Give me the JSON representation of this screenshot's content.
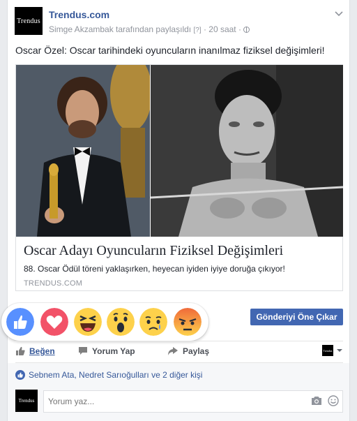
{
  "post": {
    "page_logo_text": "Trendus",
    "page_name": "Trendus.com",
    "shared_by": "Simge Akzambak tarafından paylaşıldı",
    "help_mark": "[?]",
    "separator": "·",
    "time": "20 saat",
    "separator2": "·",
    "text": "Oscar Özel: Oscar tarihindeki oyuncuların inanılmaz fiziksel değişimleri!"
  },
  "link": {
    "title": "Oscar Adayı Oyuncuların Fiziksel Değişimleri",
    "description": "88. Oscar Ödül töreni yaklaşırken, heyecan iyiden iyiye doruğa çıkıyor!",
    "domain": "TRENDUS.COM"
  },
  "reactions": [
    "like",
    "love",
    "haha",
    "wow",
    "sad",
    "angry"
  ],
  "boost_label": "Gönderiyi Öne Çıkar",
  "actions": {
    "like": "Beğen",
    "comment": "Yorum Yap",
    "share": "Paylaş"
  },
  "likers_text": "Sebnem Ata, Nedret Sarıoğulları ve 2 diğer kişi",
  "comment": {
    "avatar_text": "Trendus",
    "placeholder": "Yorum yaz..."
  },
  "colors": {
    "brand": "#4267b2",
    "link": "#365899"
  }
}
